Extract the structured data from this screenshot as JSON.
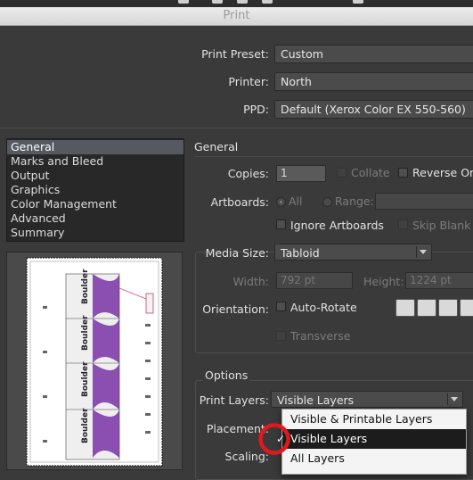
{
  "window": {
    "title": "Print"
  },
  "top": {
    "print_preset": {
      "label": "Print Preset:",
      "value": "Custom"
    },
    "printer": {
      "label": "Printer:",
      "value": "North"
    },
    "ppd": {
      "label": "PPD:",
      "value": "Default (Xerox Color EX 550-560)"
    }
  },
  "sidebar": {
    "items": [
      {
        "label": "General"
      },
      {
        "label": "Marks and Bleed"
      },
      {
        "label": "Output"
      },
      {
        "label": "Graphics"
      },
      {
        "label": "Color Management"
      },
      {
        "label": "Advanced"
      },
      {
        "label": "Summary"
      }
    ],
    "selected_index": 0
  },
  "preview": {
    "brand_text": "Boulder"
  },
  "general": {
    "heading": "General",
    "copies": {
      "label": "Copies:",
      "value": "1"
    },
    "collate": {
      "label": "Collate",
      "checked": false,
      "enabled": false
    },
    "reverse_order": {
      "label": "Reverse Orc",
      "checked": false
    },
    "artboards": {
      "label": "Artboards:",
      "all_label": "All",
      "range_label": "Range:",
      "range_value": ""
    },
    "ignore_artboards": {
      "label": "Ignore Artboards",
      "checked": false
    },
    "skip_blank": {
      "label": "Skip Blank A",
      "checked": false,
      "enabled": false
    }
  },
  "media": {
    "size": {
      "label": "Media Size:",
      "value": "Tabloid"
    },
    "width": {
      "label": "Width:",
      "value": "792 pt"
    },
    "height": {
      "label": "Height:",
      "value": "1224 pt"
    },
    "orientation": {
      "label": "Orientation:"
    },
    "auto_rotate": {
      "label": "Auto-Rotate",
      "checked": false
    },
    "transverse": {
      "label": "Transverse",
      "checked": false,
      "enabled": false
    }
  },
  "options": {
    "heading": "Options",
    "print_layers": {
      "label": "Print Layers:",
      "value": "Visible Layers"
    },
    "placement": {
      "label": "Placement:"
    },
    "scaling": {
      "label": "Scaling:"
    },
    "layer_options": [
      {
        "label": "Visible & Printable Layers",
        "checked": false
      },
      {
        "label": "Visible Layers",
        "checked": true
      },
      {
        "label": "All Layers",
        "checked": false
      }
    ]
  },
  "colors": {
    "annotation": "#e0191f",
    "preview_purple": "#8a4fb0"
  }
}
